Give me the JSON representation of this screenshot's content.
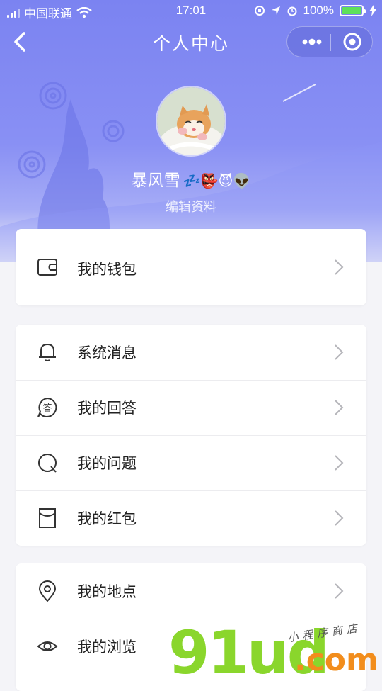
{
  "status_bar": {
    "carrier": "中国联通",
    "time": "17:01",
    "battery": "100%"
  },
  "nav": {
    "title": "个人中心"
  },
  "profile": {
    "name": "暴风雪",
    "emojis": "💤👺😈👽",
    "edit_label": "编辑资料"
  },
  "menu": {
    "group1": [
      {
        "label": "我的钱包",
        "icon": "wallet-icon"
      }
    ],
    "group2": [
      {
        "label": "系统消息",
        "icon": "bell-icon"
      },
      {
        "label": "我的回答",
        "icon": "answer-icon",
        "icon_char": "答"
      },
      {
        "label": "我的问题",
        "icon": "question-icon"
      },
      {
        "label": "我的红包",
        "icon": "red-envelope-icon"
      }
    ],
    "group3": [
      {
        "label": "我的地点",
        "icon": "location-pin-icon"
      },
      {
        "label": "我的浏览",
        "icon": "eye-icon"
      }
    ]
  },
  "watermark": {
    "text": "91ud",
    "suffix": ".com",
    "subtitle": "小程序商店"
  },
  "colors": {
    "header": "#7b83f1",
    "battery": "#5ee05a",
    "watermark_green": "#8ad62c",
    "watermark_orange": "#f28d1c"
  }
}
